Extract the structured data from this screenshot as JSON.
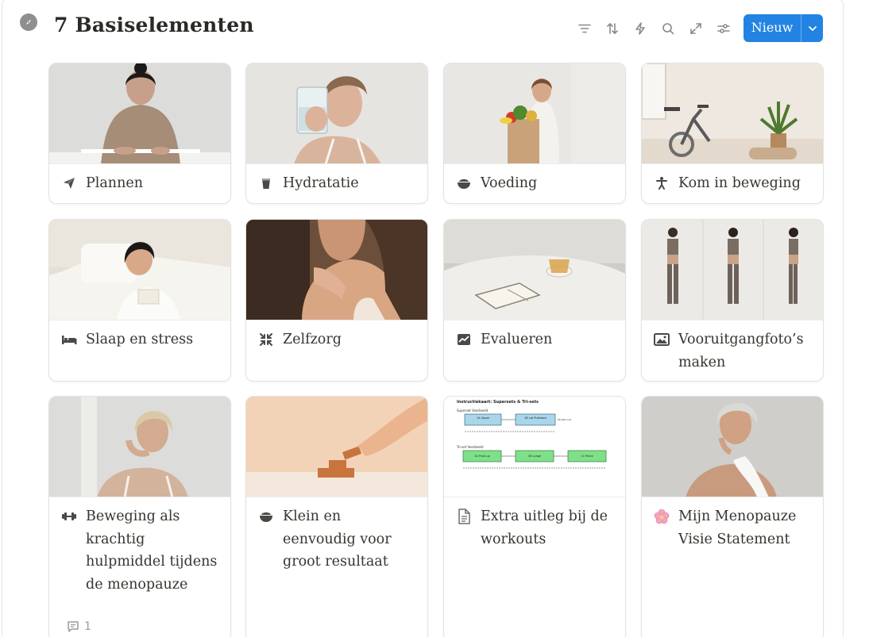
{
  "header": {
    "title": "7 Basiselementen",
    "new_button_label": "Nieuw"
  },
  "toolbar": [
    "filter-icon",
    "sort-icon",
    "automation-icon",
    "search-icon",
    "expand-icon",
    "settings-icon"
  ],
  "cards": [
    {
      "title": "Plannen",
      "icon": "send-icon"
    },
    {
      "title": "Hydratatie",
      "icon": "cup-icon"
    },
    {
      "title": "Voeding",
      "icon": "bowl-icon"
    },
    {
      "title": "Kom in beweging",
      "icon": "figure-icon"
    },
    {
      "title": "Slaap en stress",
      "icon": "bed-icon"
    },
    {
      "title": "Zelfzorg",
      "icon": "collapse-icon"
    },
    {
      "title": "Evalueren",
      "icon": "chart-icon"
    },
    {
      "title": "Vooruitgangfoto’s maken",
      "icon": "image-icon"
    },
    {
      "title": "Beweging als krachtig hulpmiddel tijdens de menopauze",
      "icon": "dumbbell-icon",
      "comments": "1"
    },
    {
      "title": "Klein en eenvoudig voor groot resultaat",
      "icon": "bowl-icon"
    },
    {
      "title": "Extra uitleg bij de workouts",
      "icon": "document-icon"
    },
    {
      "title": "Mijn Menopauze Visie Statement",
      "icon": "flower-icon"
    }
  ],
  "diagram": {
    "heading": "Instructiekaart: Supersets & Tri-sets",
    "superset_label": "Superset Voorbeeld",
    "triset_label": "Tri-set Voorbeeld",
    "superset_boxes": [
      "1A Squat",
      "1B Lat Pulldown"
    ],
    "triset_boxes": [
      "1A Push-up",
      "1B Lunge",
      "1C Plank"
    ],
    "rest_label": "60-90s rust"
  }
}
